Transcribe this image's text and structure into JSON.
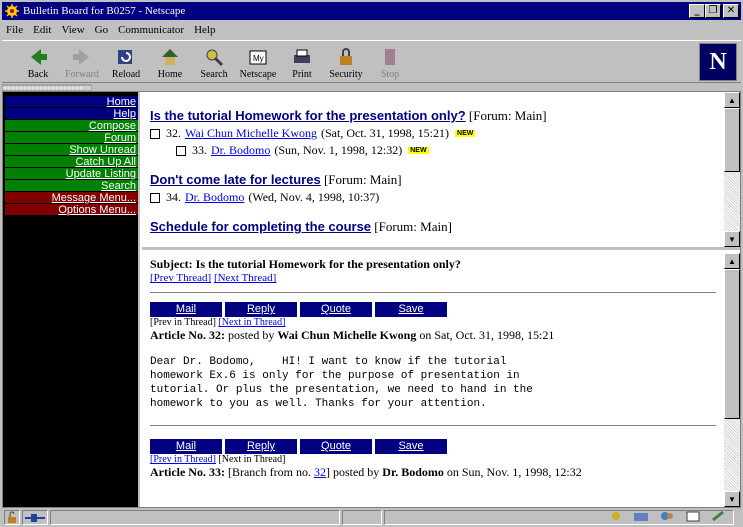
{
  "window": {
    "title": "Bulletin Board for B0257 - Netscape"
  },
  "menu": [
    "File",
    "Edit",
    "View",
    "Go",
    "Communicator",
    "Help"
  ],
  "toolbar": {
    "back": "Back",
    "forward": "Forward",
    "reload": "Reload",
    "home": "Home",
    "search": "Search",
    "netscape": "Netscape",
    "print": "Print",
    "security": "Security",
    "stop": "Stop"
  },
  "brand": {
    "logo": "N"
  },
  "nav": [
    {
      "label": "Home",
      "color": "blue"
    },
    {
      "label": "Help",
      "color": "blue"
    },
    {
      "label": "Compose",
      "color": "green"
    },
    {
      "label": "Forum",
      "color": "green"
    },
    {
      "label": "Show Unread",
      "color": "green"
    },
    {
      "label": "Catch Up All",
      "color": "green"
    },
    {
      "label": "Update Listing",
      "color": "green"
    },
    {
      "label": "Search",
      "color": "green"
    },
    {
      "label": "Message Menu...",
      "color": "red"
    },
    {
      "label": "Options Menu...",
      "color": "red"
    }
  ],
  "threads": {
    "t1": {
      "title": "Is the tutorial Homework for the presentation only?",
      "forum": "[Forum: Main]",
      "r1": {
        "num": "32.",
        "author": "Wai Chun Michelle Kwong",
        "date": "(Sat, Oct. 31, 1998, 15:21)",
        "badge": "NEW"
      },
      "r2": {
        "num": "33.",
        "author": "Dr. Bodomo",
        "date": "(Sun, Nov. 1, 1998, 12:32)",
        "badge": "NEW"
      }
    },
    "t2": {
      "title": "Don't come late for lectures",
      "forum": "[Forum: Main]",
      "r1": {
        "num": "34.",
        "author": "Dr. Bodomo",
        "date": "(Wed, Nov. 4, 1998, 10:37)"
      }
    },
    "t3": {
      "title": "Schedule for completing the course",
      "forum": "[Forum: Main]"
    }
  },
  "article": {
    "subject": "Subject: Is the tutorial Homework for the presentation only?",
    "prev_thread": "[Prev Thread]",
    "next_thread": "[Next Thread]",
    "buttons": {
      "mail": "Mail",
      "reply": "Reply",
      "quote": "Quote",
      "save": "Save"
    },
    "a1": {
      "prev_in": "[Prev in Thread]",
      "next_in": "[Next in Thread]",
      "label": "Article No. 32:",
      "posted": " posted by ",
      "author": "Wai Chun Michelle Kwong",
      "on": " on Sat, Oct. 31, 1998, 15:21",
      "body": "Dear Dr. Bodomo,    HI! I want to know if the tutorial\nhomework Ex.6 is only for the purpose of presentation in\ntutorial. Or plus the presentation, we need to hand in the\nhomework to you as well. Thanks for your attention."
    },
    "a2": {
      "prev_in": "[Prev in Thread]",
      "next_in": "[Next in Thread]",
      "label": "Article No. 33:",
      "branch_pre": " [Branch from no. ",
      "branch_num": "32",
      "branch_post": "] posted by ",
      "author": "Dr. Bodomo",
      "on": " on Sun, Nov. 1, 1998, 12:32"
    }
  }
}
